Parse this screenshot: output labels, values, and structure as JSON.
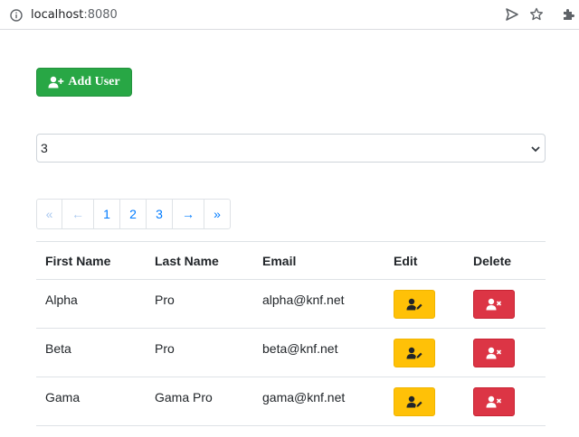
{
  "browser": {
    "url_host": "localhost",
    "url_port": ":8080"
  },
  "toolbar": {
    "add_user_label": "Add User"
  },
  "page_size_select": {
    "selected": "3"
  },
  "pagination": {
    "first": "«",
    "prev": "←",
    "pages": [
      "1",
      "2",
      "3"
    ],
    "next": "→",
    "last": "»"
  },
  "table": {
    "headers": {
      "first_name": "First Name",
      "last_name": "Last Name",
      "email": "Email",
      "edit": "Edit",
      "delete": "Delete"
    },
    "rows": [
      {
        "first_name": "Alpha",
        "last_name": "Pro",
        "email": "alpha@knf.net"
      },
      {
        "first_name": "Beta",
        "last_name": "Pro",
        "email": "beta@knf.net"
      },
      {
        "first_name": "Gama",
        "last_name": "Gama Pro",
        "email": "gama@knf.net"
      }
    ]
  },
  "colors": {
    "success": "#28a745",
    "warning": "#ffc107",
    "danger": "#dc3545",
    "link": "#007bff"
  }
}
